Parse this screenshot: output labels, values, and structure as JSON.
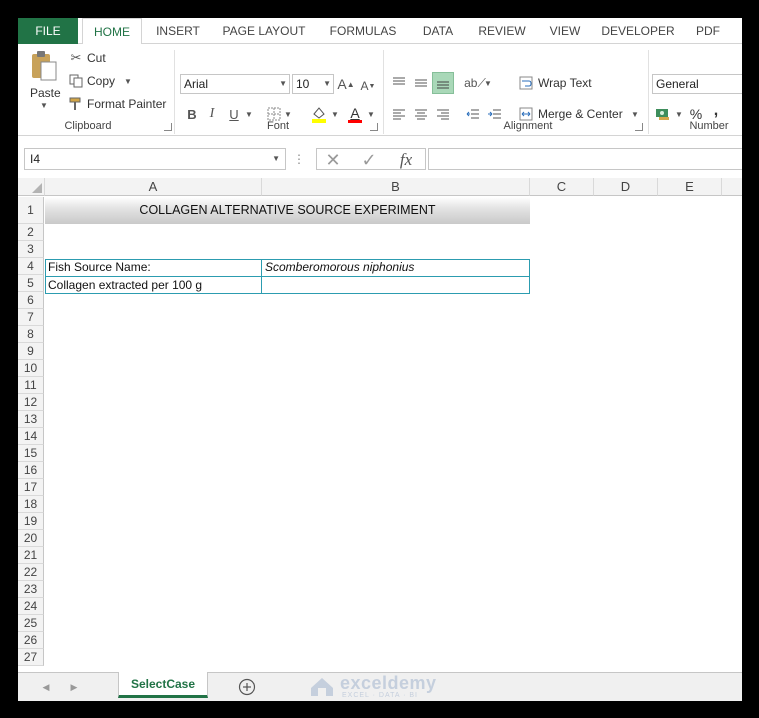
{
  "ribbon_tabs": [
    "FILE",
    "HOME",
    "INSERT",
    "PAGE LAYOUT",
    "FORMULAS",
    "DATA",
    "REVIEW",
    "VIEW",
    "DEVELOPER",
    "PDF"
  ],
  "active_tab": "HOME",
  "clipboard": {
    "paste_label": "Paste",
    "cut_label": "Cut",
    "copy_label": "Copy",
    "format_painter_label": "Format Painter",
    "group_label": "Clipboard"
  },
  "font": {
    "family": "Arial",
    "size": "10",
    "bold": "B",
    "italic": "I",
    "underline": "U",
    "grow": "A",
    "shrink": "A",
    "color_letter": "A",
    "group_label": "Font",
    "fill_color": "#FFFF00",
    "font_color": "#FF0000"
  },
  "alignment": {
    "wrap_text_label": "Wrap Text",
    "merge_label": "Merge & Center",
    "group_label": "Alignment"
  },
  "number": {
    "format": "General",
    "percent": "%",
    "comma": ",",
    "group_label": "Number"
  },
  "formula_bar": {
    "name_box": "I4",
    "fx": "fx",
    "formula": ""
  },
  "columns": [
    "A",
    "B",
    "C",
    "D",
    "E"
  ],
  "rows": [
    "1",
    "2",
    "3",
    "4",
    "5",
    "6",
    "7",
    "8",
    "9",
    "10",
    "11",
    "12",
    "13",
    "14",
    "15",
    "16",
    "17",
    "18",
    "19",
    "20",
    "21",
    "22",
    "23",
    "24",
    "25",
    "26",
    "27"
  ],
  "cells": {
    "title": "COLLAGEN ALTERNATIVE SOURCE EXPERIMENT",
    "a4": "Fish Source Name:",
    "b4": "Scomberomorous niphonius",
    "a5": "Collagen extracted per 100 g",
    "b5": ""
  },
  "sheet_tabs": [
    "SelectCase"
  ],
  "watermark": {
    "name": "exceldemy",
    "tagline": "EXCEL · DATA · BI"
  },
  "colors": {
    "excel_green": "#217346",
    "table_border": "#2C9CB0",
    "header_bg": "#F3F3F3",
    "selected_align": "#A9D8B8"
  }
}
